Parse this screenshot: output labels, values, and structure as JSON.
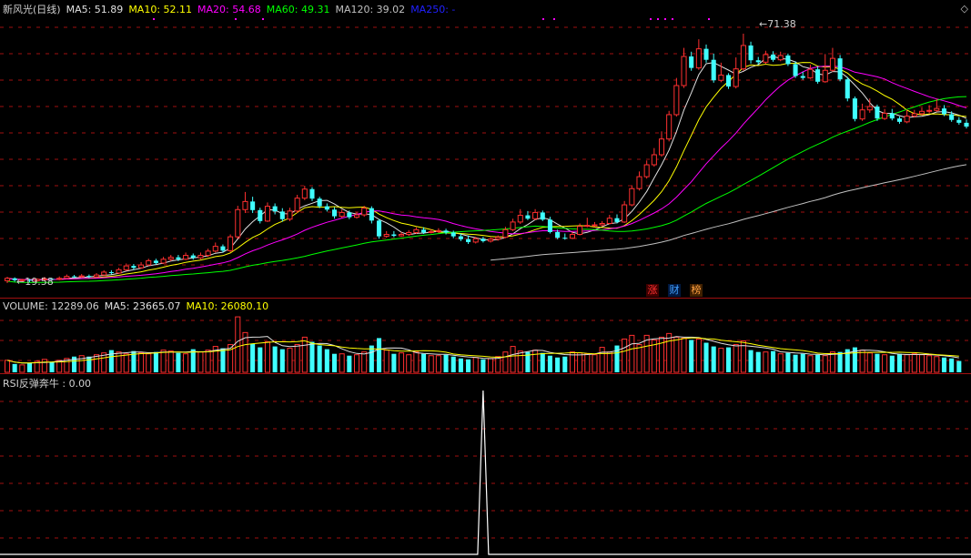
{
  "main_panel": {
    "legend": [
      {
        "label": "新风光(日线)",
        "color": "#d0d0d0"
      },
      {
        "label": "MA5: 51.89",
        "color": "#e0e0e0"
      },
      {
        "label": "MA10: 52.11",
        "color": "#ffff00"
      },
      {
        "label": "MA20: 54.68",
        "color": "#ff00ff"
      },
      {
        "label": "MA60: 49.31",
        "color": "#00ff00"
      },
      {
        "label": "MA120: 39.02",
        "color": "#c0c0c0"
      },
      {
        "label": "MA250: -",
        "color": "#2020ff"
      }
    ],
    "high_label": "71.38",
    "low_label": "19.58",
    "news_icons": [
      {
        "label": "涨",
        "color": "#ff3030",
        "bg": "#400000"
      },
      {
        "label": "财",
        "color": "#40a0ff",
        "bg": "#001840"
      },
      {
        "label": "榜",
        "color": "#ffa040",
        "bg": "#402000"
      }
    ],
    "corner_icon": "◇"
  },
  "volume_panel": {
    "legend": [
      {
        "label": "VOLUME: 12289.06",
        "color": "#d0d0d0"
      },
      {
        "label": "MA5: 23665.07",
        "color": "#e0e0e0"
      },
      {
        "label": "MA10: 26080.10",
        "color": "#ffff00"
      }
    ]
  },
  "rsi_panel": {
    "legend": [
      {
        "label": "RSI反弹奔牛 : 0.00",
        "color": "#d0d0d0"
      }
    ]
  },
  "colors": {
    "up": "#ff3030",
    "down": "#40ffff",
    "background": "#000000",
    "grid": "#a01010"
  },
  "chart_data": [
    {
      "type": "candlestick",
      "title": "新风光(日线)",
      "ylim": [
        17,
        75
      ],
      "candles": [
        [
          19.6,
          20.1,
          19.1,
          20.4
        ],
        [
          20.1,
          19.7,
          19.4,
          20.3
        ],
        [
          19.7,
          19.8,
          19.4,
          20.0
        ],
        [
          19.8,
          19.6,
          19.3,
          20.0
        ],
        [
          19.6,
          19.9,
          19.4,
          20.1
        ],
        [
          19.9,
          20.0,
          19.7,
          20.4
        ],
        [
          20.0,
          19.9,
          19.6,
          20.2
        ],
        [
          19.9,
          20.1,
          19.7,
          20.5
        ],
        [
          20.1,
          20.5,
          20.0,
          20.9
        ],
        [
          20.5,
          20.4,
          20.1,
          20.8
        ],
        [
          20.4,
          20.6,
          20.2,
          21.0
        ],
        [
          20.6,
          20.4,
          20.1,
          20.9
        ],
        [
          20.4,
          20.8,
          20.2,
          21.2
        ],
        [
          20.8,
          21.4,
          20.6,
          21.8
        ],
        [
          21.4,
          21.2,
          20.9,
          21.8
        ],
        [
          21.2,
          21.9,
          21.0,
          22.3
        ],
        [
          21.9,
          22.7,
          21.7,
          23.2
        ],
        [
          22.7,
          22.3,
          21.9,
          23.1
        ],
        [
          22.3,
          22.9,
          22.1,
          23.5
        ],
        [
          22.9,
          23.8,
          22.7,
          24.2
        ],
        [
          23.8,
          23.3,
          22.9,
          24.2
        ],
        [
          23.3,
          24.1,
          23.1,
          24.6
        ],
        [
          24.1,
          24.5,
          23.7,
          25.0
        ],
        [
          24.5,
          24.1,
          23.7,
          25.0
        ],
        [
          24.1,
          24.9,
          23.9,
          25.5
        ],
        [
          24.9,
          24.4,
          24.0,
          25.3
        ],
        [
          24.4,
          24.9,
          24.1,
          25.5
        ],
        [
          24.9,
          25.8,
          24.6,
          26.3
        ],
        [
          25.8,
          26.8,
          25.5,
          27.6
        ],
        [
          26.8,
          25.9,
          25.5,
          27.2
        ],
        [
          25.9,
          28.8,
          25.6,
          29.3
        ],
        [
          28.8,
          34.5,
          28.5,
          35.3
        ],
        [
          34.5,
          36.2,
          33.8,
          38.2
        ],
        [
          36.2,
          34.4,
          33.8,
          37.2
        ],
        [
          34.4,
          32.1,
          31.6,
          34.9
        ],
        [
          32.1,
          35.2,
          31.9,
          36.0
        ],
        [
          35.2,
          34.1,
          33.5,
          35.8
        ],
        [
          34.1,
          32.5,
          32.0,
          34.8
        ],
        [
          32.5,
          34.2,
          32.1,
          34.9
        ],
        [
          34.2,
          36.9,
          33.8,
          37.6
        ],
        [
          36.9,
          38.8,
          36.5,
          39.5
        ],
        [
          38.8,
          36.8,
          36.3,
          39.2
        ],
        [
          36.8,
          35.2,
          34.8,
          37.2
        ],
        [
          35.2,
          34.5,
          34.1,
          35.8
        ],
        [
          34.5,
          33.1,
          32.6,
          35.0
        ],
        [
          33.1,
          33.9,
          32.8,
          34.5
        ],
        [
          33.9,
          32.9,
          32.5,
          34.3
        ],
        [
          32.9,
          33.4,
          32.6,
          34.0
        ],
        [
          33.4,
          34.8,
          33.0,
          35.3
        ],
        [
          34.8,
          32.2,
          31.6,
          35.2
        ],
        [
          32.2,
          28.9,
          28.4,
          32.5
        ],
        [
          28.9,
          29.3,
          28.6,
          30.0
        ],
        [
          29.3,
          29.0,
          28.7,
          30.0
        ],
        [
          29.0,
          29.3,
          28.8,
          29.8
        ],
        [
          29.3,
          29.7,
          29.0,
          30.2
        ],
        [
          29.7,
          30.3,
          29.4,
          30.8
        ],
        [
          30.3,
          29.7,
          29.4,
          30.8
        ],
        [
          29.7,
          29.9,
          29.5,
          30.4
        ],
        [
          29.9,
          30.1,
          29.6,
          30.6
        ],
        [
          30.1,
          29.7,
          29.3,
          30.5
        ],
        [
          29.7,
          28.9,
          28.5,
          30.1
        ],
        [
          28.9,
          28.3,
          27.9,
          29.5
        ],
        [
          28.3,
          27.7,
          27.3,
          29.1
        ],
        [
          27.7,
          28.4,
          27.4,
          28.8
        ],
        [
          28.4,
          27.9,
          27.6,
          28.8
        ],
        [
          27.9,
          28.3,
          27.6,
          28.7
        ],
        [
          28.3,
          28.7,
          28.0,
          29.1
        ],
        [
          28.7,
          30.3,
          28.5,
          30.9
        ],
        [
          30.3,
          31.9,
          30.0,
          32.6
        ],
        [
          31.9,
          33.3,
          31.5,
          34.6
        ],
        [
          33.3,
          32.6,
          32.3,
          34.2
        ],
        [
          32.6,
          33.9,
          32.3,
          34.6
        ],
        [
          33.9,
          32.4,
          32.1,
          34.3
        ],
        [
          32.4,
          29.8,
          29.5,
          33.0
        ],
        [
          29.8,
          28.6,
          28.3,
          30.3
        ],
        [
          28.6,
          28.5,
          28.2,
          29.5
        ],
        [
          28.5,
          29.3,
          28.3,
          29.9
        ],
        [
          29.3,
          31.0,
          29.1,
          31.6
        ],
        [
          31.0,
          31.2,
          30.8,
          32.8
        ],
        [
          31.2,
          31.3,
          30.9,
          31.9
        ],
        [
          31.3,
          31.6,
          31.0,
          32.1
        ],
        [
          31.6,
          32.7,
          31.4,
          33.4
        ],
        [
          32.7,
          31.9,
          31.6,
          33.5
        ],
        [
          31.9,
          35.5,
          31.7,
          36.3
        ],
        [
          35.5,
          38.9,
          35.2,
          39.6
        ],
        [
          38.9,
          41.4,
          38.5,
          42.5
        ],
        [
          41.4,
          43.9,
          41.0,
          44.8
        ],
        [
          43.9,
          46.0,
          43.5,
          47.4
        ],
        [
          46.0,
          49.3,
          45.6,
          50.9
        ],
        [
          49.3,
          54.4,
          48.8,
          55.2
        ],
        [
          54.4,
          60.5,
          54.0,
          62.1
        ],
        [
          60.5,
          66.6,
          60.0,
          68.4
        ],
        [
          66.6,
          64.2,
          63.6,
          67.6
        ],
        [
          64.2,
          68.2,
          63.8,
          70.2
        ],
        [
          68.2,
          65.9,
          65.3,
          69.1
        ],
        [
          65.9,
          61.6,
          61.1,
          67.2
        ],
        [
          61.6,
          62.7,
          61.2,
          65.3
        ],
        [
          62.7,
          60.3,
          59.8,
          63.1
        ],
        [
          60.3,
          64.0,
          59.9,
          66.4
        ],
        [
          64.0,
          68.9,
          63.6,
          71.38
        ],
        [
          68.9,
          65.8,
          65.1,
          69.7
        ],
        [
          65.8,
          65.4,
          64.9,
          66.5
        ],
        [
          65.4,
          67.0,
          65.0,
          67.8
        ],
        [
          67.0,
          65.9,
          65.5,
          67.7
        ],
        [
          65.9,
          66.8,
          65.6,
          67.6
        ],
        [
          66.8,
          65.0,
          64.6,
          67.2
        ],
        [
          65.0,
          62.5,
          62.1,
          65.6
        ],
        [
          62.5,
          62.1,
          61.7,
          63.4
        ],
        [
          62.1,
          63.9,
          61.9,
          64.9
        ],
        [
          63.9,
          61.3,
          60.9,
          64.5
        ],
        [
          61.3,
          63.7,
          61.1,
          67.1
        ],
        [
          63.7,
          66.2,
          63.4,
          68.4
        ],
        [
          66.2,
          61.8,
          61.4,
          66.9
        ],
        [
          61.8,
          57.8,
          57.2,
          62.3
        ],
        [
          57.8,
          53.5,
          53.0,
          58.2
        ],
        [
          53.5,
          55.4,
          53.1,
          56.7
        ],
        [
          55.4,
          56.1,
          54.8,
          57.8
        ],
        [
          56.1,
          53.6,
          53.1,
          56.5
        ],
        [
          53.6,
          54.7,
          53.3,
          55.6
        ],
        [
          54.7,
          53.6,
          53.2,
          55.6
        ],
        [
          53.6,
          52.9,
          52.5,
          54.0
        ],
        [
          52.9,
          54.1,
          52.6,
          55.5
        ],
        [
          54.1,
          54.6,
          53.8,
          55.4
        ],
        [
          54.6,
          55.1,
          54.2,
          55.9
        ],
        [
          55.1,
          55.3,
          54.7,
          56.4
        ],
        [
          55.3,
          55.7,
          55.0,
          57.7
        ],
        [
          55.7,
          54.5,
          54.1,
          56.4
        ],
        [
          54.5,
          53.3,
          52.9,
          55.1
        ],
        [
          53.3,
          52.7,
          52.3,
          53.9
        ],
        [
          52.7,
          51.9,
          51.5,
          53.4
        ]
      ],
      "ma": [
        {
          "name": "MA5",
          "color": "#e0e0e0",
          "values": []
        },
        {
          "name": "MA10",
          "color": "#ffff00",
          "values": []
        },
        {
          "name": "MA20",
          "color": "#ff00ff",
          "values": []
        },
        {
          "name": "MA60",
          "color": "#00ff00",
          "values": []
        },
        {
          "name": "MA120",
          "color": "#c0c0c0",
          "values": []
        }
      ]
    },
    {
      "type": "bar",
      "title": "VOLUME",
      "ylim": [
        0,
        66000
      ],
      "values": [
        13000,
        9000,
        8000,
        10000,
        12000,
        14000,
        11000,
        13000,
        15000,
        17000,
        18000,
        17000,
        19000,
        21000,
        24000,
        22000,
        20000,
        23000,
        21000,
        20000,
        22000,
        24000,
        23000,
        21000,
        20000,
        25000,
        22000,
        24000,
        28000,
        26000,
        30000,
        60000,
        43000,
        31000,
        27000,
        33000,
        28000,
        25000,
        26000,
        30000,
        38000,
        33000,
        29000,
        25000,
        20000,
        20000,
        18000,
        19000,
        22000,
        29000,
        37000,
        24000,
        20000,
        21000,
        19000,
        22000,
        20000,
        18000,
        18000,
        19000,
        17000,
        15000,
        14000,
        16000,
        14000,
        15000,
        17000,
        22000,
        28000,
        23000,
        22000,
        24000,
        21000,
        18000,
        16000,
        17000,
        22000,
        21000,
        20000,
        19000,
        27000,
        22000,
        29000,
        36000,
        40000,
        30000,
        40000,
        35000,
        38000,
        42000,
        38000,
        37000,
        35000,
        36000,
        32000,
        28000,
        26000,
        27000,
        30000,
        34000,
        24000,
        22000,
        22000,
        23000,
        20000,
        21000,
        19000,
        20000,
        18000,
        19000,
        18000,
        22000,
        22000,
        25000,
        27000,
        24000,
        21000,
        20000,
        19000,
        18000,
        20000,
        19000,
        20000,
        19000,
        18000,
        17000,
        16000,
        15000,
        12289.06
      ],
      "ma": [
        {
          "name": "MA5",
          "color": "#e0e0e0",
          "values": []
        },
        {
          "name": "MA10",
          "color": "#ffff00",
          "values": []
        }
      ]
    },
    {
      "type": "line",
      "title": "RSI反弹奔牛",
      "ylim": [
        0,
        1
      ],
      "values": [
        0,
        0,
        0,
        0,
        0,
        0,
        0,
        0,
        0,
        0,
        0,
        0,
        0,
        0,
        0,
        0,
        0,
        0,
        0,
        0,
        0,
        0,
        0,
        0,
        0,
        0,
        0,
        0,
        0,
        0,
        0,
        0,
        0,
        0,
        0,
        0,
        0,
        0,
        0,
        0,
        0,
        0,
        0,
        0,
        0,
        0,
        0,
        0,
        0,
        0,
        0,
        0,
        0,
        0,
        0,
        0,
        0,
        0,
        0,
        0,
        0,
        0,
        0,
        0,
        0,
        0,
        0,
        0,
        0,
        0,
        0,
        0,
        0,
        0,
        0,
        0,
        0,
        0,
        0,
        0,
        0,
        0,
        0,
        0,
        0,
        0,
        0,
        0,
        0,
        0,
        0,
        0,
        0,
        0,
        0,
        0,
        0,
        0,
        0,
        0,
        0,
        0,
        0,
        0,
        0,
        0,
        0,
        0,
        0,
        0,
        0,
        0,
        0,
        0,
        0,
        0,
        0,
        0,
        0,
        0,
        0,
        0,
        0,
        0,
        0,
        0,
        0,
        0,
        0
      ],
      "spike_index": 64,
      "spike_value": 1
    }
  ]
}
